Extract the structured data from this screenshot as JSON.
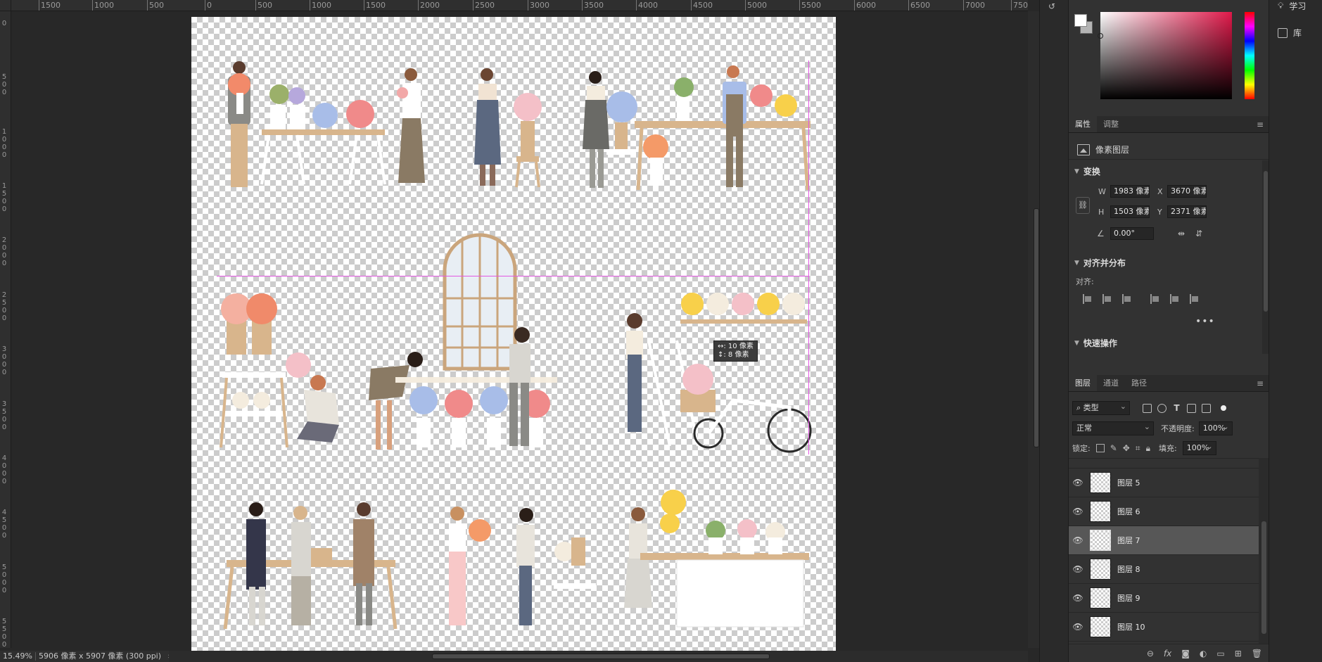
{
  "ruler": {
    "top_labels": [
      "1500",
      "1000",
      "500",
      "0",
      "500",
      "1000",
      "1500",
      "2000",
      "2500",
      "3000",
      "3500",
      "4000",
      "4500",
      "5000",
      "5500",
      "6000",
      "6500",
      "7000",
      "750"
    ],
    "left_labels": [
      "0",
      "5 0 0",
      "1 0 0 0",
      "1 5 0 0",
      "2 0 0 0",
      "2 5 0 0",
      "3 0 0 0",
      "3 5 0 0",
      "4 0 0 0",
      "4 5 0 0",
      "5 0 0 0",
      "5 5 0 0"
    ]
  },
  "tooltip": {
    "line1": "↔: 10 像素",
    "line2": "↕:  8 像素"
  },
  "status": {
    "zoom": "15.49%",
    "doc_info": "5906 像素 x 5907 像素 (300 ppi)",
    "arrow": "›"
  },
  "side_panel": {
    "learn": "学习",
    "library": "库"
  },
  "colors": {
    "accent_guide": "#e356e3",
    "picker_hue": "#e0194a",
    "background_swatch": "#b4b4b4"
  },
  "properties": {
    "tabs": [
      "属性",
      "调整"
    ],
    "layer_type": "像素图层",
    "transform": {
      "title": "变换",
      "w_label": "W",
      "w_value": "1983 像素",
      "x_label": "X",
      "x_value": "3670 像素",
      "h_label": "H",
      "h_value": "1503 像素",
      "y_label": "Y",
      "y_value": "2371 像素",
      "angle": "0.00°"
    },
    "align": {
      "title": "对齐并分布",
      "label": "对齐:",
      "more": "•••"
    },
    "quick": {
      "title": "快速操作"
    }
  },
  "layers": {
    "tabs": [
      "图层",
      "通道",
      "路径"
    ],
    "filter": "类型",
    "blend_mode": "正常",
    "opacity_label": "不透明度:",
    "opacity_value": "100%",
    "lock_label": "锁定:",
    "fill_label": "填充:",
    "fill_value": "100%",
    "items": [
      "图层 5",
      "图层 6",
      "图层 7",
      "图层 8",
      "图层 9",
      "图层 10"
    ],
    "selected": "图层 7"
  }
}
